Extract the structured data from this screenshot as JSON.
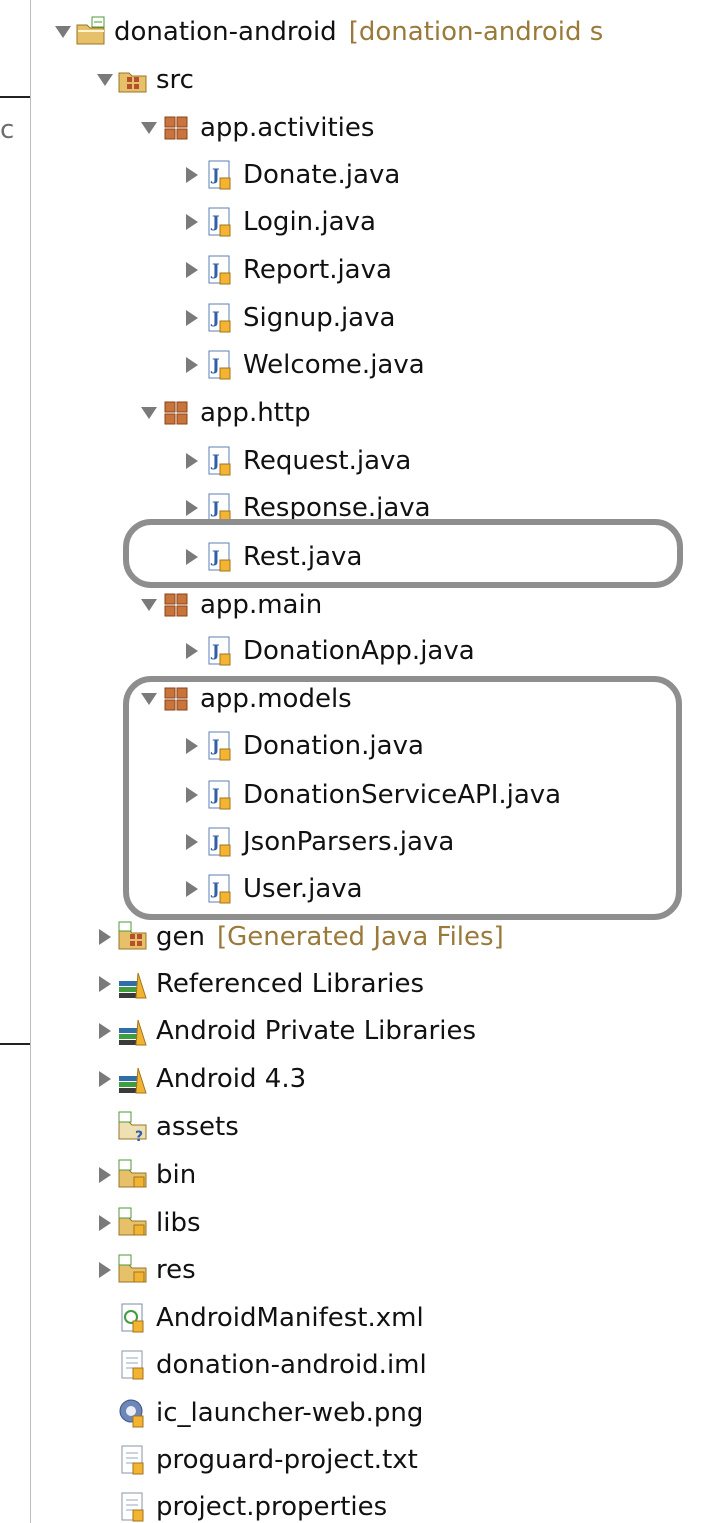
{
  "left_fragment": "c",
  "tree": [
    {
      "label": "donation-android",
      "decoration": "[donation-android s",
      "expand": "down",
      "icon": "project-icon",
      "depth": 0
    },
    {
      "label": "src",
      "expand": "down",
      "icon": "source-folder-icon",
      "depth": 1
    },
    {
      "label": "app.activities",
      "expand": "down",
      "icon": "package-icon",
      "depth": 2
    },
    {
      "label": "Donate.java",
      "expand": "right",
      "icon": "java-file-icon",
      "depth": 3
    },
    {
      "label": "Login.java",
      "expand": "right",
      "icon": "java-file-icon",
      "depth": 3
    },
    {
      "label": "Report.java",
      "expand": "right",
      "icon": "java-file-icon",
      "depth": 3
    },
    {
      "label": "Signup.java",
      "expand": "right",
      "icon": "java-file-icon",
      "depth": 3
    },
    {
      "label": "Welcome.java",
      "expand": "right",
      "icon": "java-file-icon",
      "depth": 3
    },
    {
      "label": "app.http",
      "expand": "down",
      "icon": "package-icon",
      "depth": 2
    },
    {
      "label": "Request.java",
      "expand": "right",
      "icon": "java-file-icon",
      "depth": 3
    },
    {
      "label": "Response.java",
      "expand": "right",
      "icon": "java-file-icon",
      "depth": 3
    },
    {
      "label": "Rest.java",
      "expand": "right",
      "icon": "java-file-icon",
      "depth": 3
    },
    {
      "label": "app.main",
      "expand": "down",
      "icon": "package-icon",
      "depth": 2
    },
    {
      "label": "DonationApp.java",
      "expand": "right",
      "icon": "java-file-icon",
      "depth": 3
    },
    {
      "label": "app.models",
      "expand": "down",
      "icon": "package-icon",
      "depth": 2
    },
    {
      "label": "Donation.java",
      "expand": "right",
      "icon": "java-file-icon",
      "depth": 3
    },
    {
      "label": "DonationServiceAPI.java",
      "expand": "right",
      "icon": "java-file-icon",
      "depth": 3
    },
    {
      "label": "JsonParsers.java",
      "expand": "right",
      "icon": "java-file-icon",
      "depth": 3
    },
    {
      "label": "User.java",
      "expand": "right",
      "icon": "java-file-icon",
      "depth": 3
    },
    {
      "label": "gen",
      "decoration": "[Generated Java Files]",
      "expand": "right",
      "icon": "generated-folder-icon",
      "depth": 1
    },
    {
      "label": "Referenced Libraries",
      "expand": "right",
      "icon": "library-icon",
      "depth": 1
    },
    {
      "label": "Android Private Libraries",
      "expand": "right",
      "icon": "library-icon",
      "depth": 1
    },
    {
      "label": "Android 4.3",
      "expand": "right",
      "icon": "library-icon",
      "depth": 1
    },
    {
      "label": "assets",
      "expand": "none",
      "icon": "assets-folder-icon",
      "depth": 1
    },
    {
      "label": "bin",
      "expand": "right",
      "icon": "folder-icon",
      "depth": 1
    },
    {
      "label": "libs",
      "expand": "right",
      "icon": "folder-icon",
      "depth": 1
    },
    {
      "label": "res",
      "expand": "right",
      "icon": "folder-icon",
      "depth": 1
    },
    {
      "label": "AndroidManifest.xml",
      "expand": "none",
      "icon": "manifest-file-icon",
      "depth": 1
    },
    {
      "label": "donation-android.iml",
      "expand": "none",
      "icon": "text-file-icon",
      "depth": 1
    },
    {
      "label": "ic_launcher-web.png",
      "expand": "none",
      "icon": "image-file-icon",
      "depth": 1
    },
    {
      "label": "proguard-project.txt",
      "expand": "none",
      "icon": "text-file-icon",
      "depth": 1
    },
    {
      "label": "project.properties",
      "expand": "none",
      "icon": "text-file-icon",
      "depth": 1
    }
  ],
  "colors": {
    "text": "#111111",
    "decoration": "#9a7a3b",
    "highlight_border": "#8e8e8e",
    "arrow": "#7a7a7a"
  }
}
